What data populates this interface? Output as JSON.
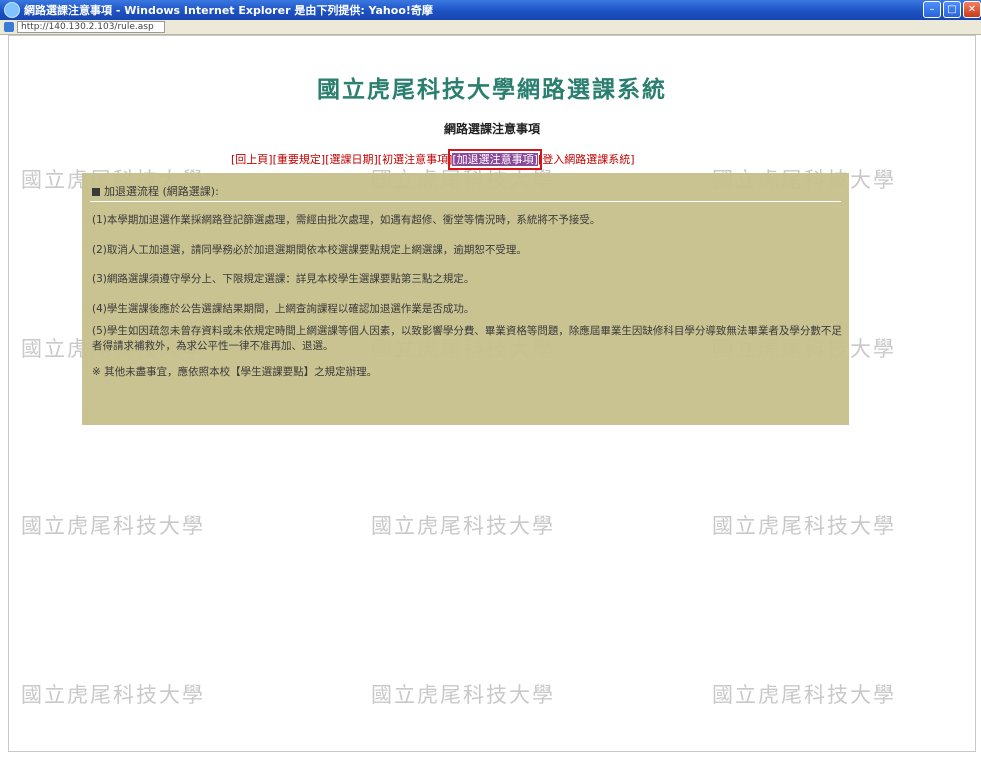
{
  "window": {
    "title": "網路選課注意事項 - Windows Internet Explorer 是由下列提供: Yahoo!奇摩",
    "url": "http://140.130.2.103/rule.asp"
  },
  "watermark": "國立虎尾科技大學",
  "page": {
    "heading": "國立虎尾科技大學網路選課系統",
    "subtitle": "網路選課注意事項"
  },
  "nav": [
    "[回上頁]",
    "[重要規定]",
    "[選課日期]",
    "[初選注意事項]",
    "[加退選注意事項]",
    "[登入網路選課系統]"
  ],
  "panel": {
    "title": "加退選流程 (網路選課):",
    "items": [
      "(1)本學期加退選作業採網路登記篩選處理，需經由批次處理，如遇有超修、衝堂等情況時，系統將不予接受。",
      "(2)取消人工加退選，請同學務必於加退選期間依本校選課要點規定上網選課，逾期恕不受理。",
      "(3)網路選課須遵守學分上、下限規定選課：詳見本校學生選課要點第三點之規定。",
      "(4)學生選課後應於公告選課結果期間，上網查詢課程以確認加退選作業是否成功。",
      "(5)學生如因疏忽未曾存資料或未依規定時間上網選課等個人因素，以致影響學分費、畢業資格等問題，除應屆畢業生因缺修科目學分導致無法畢業者及學分數不足者得請求補救外，為求公平性一律不准再加、退選。",
      "※ 其他未盡事宜，應依照本校【學生選課要點】之規定辦理。"
    ]
  }
}
